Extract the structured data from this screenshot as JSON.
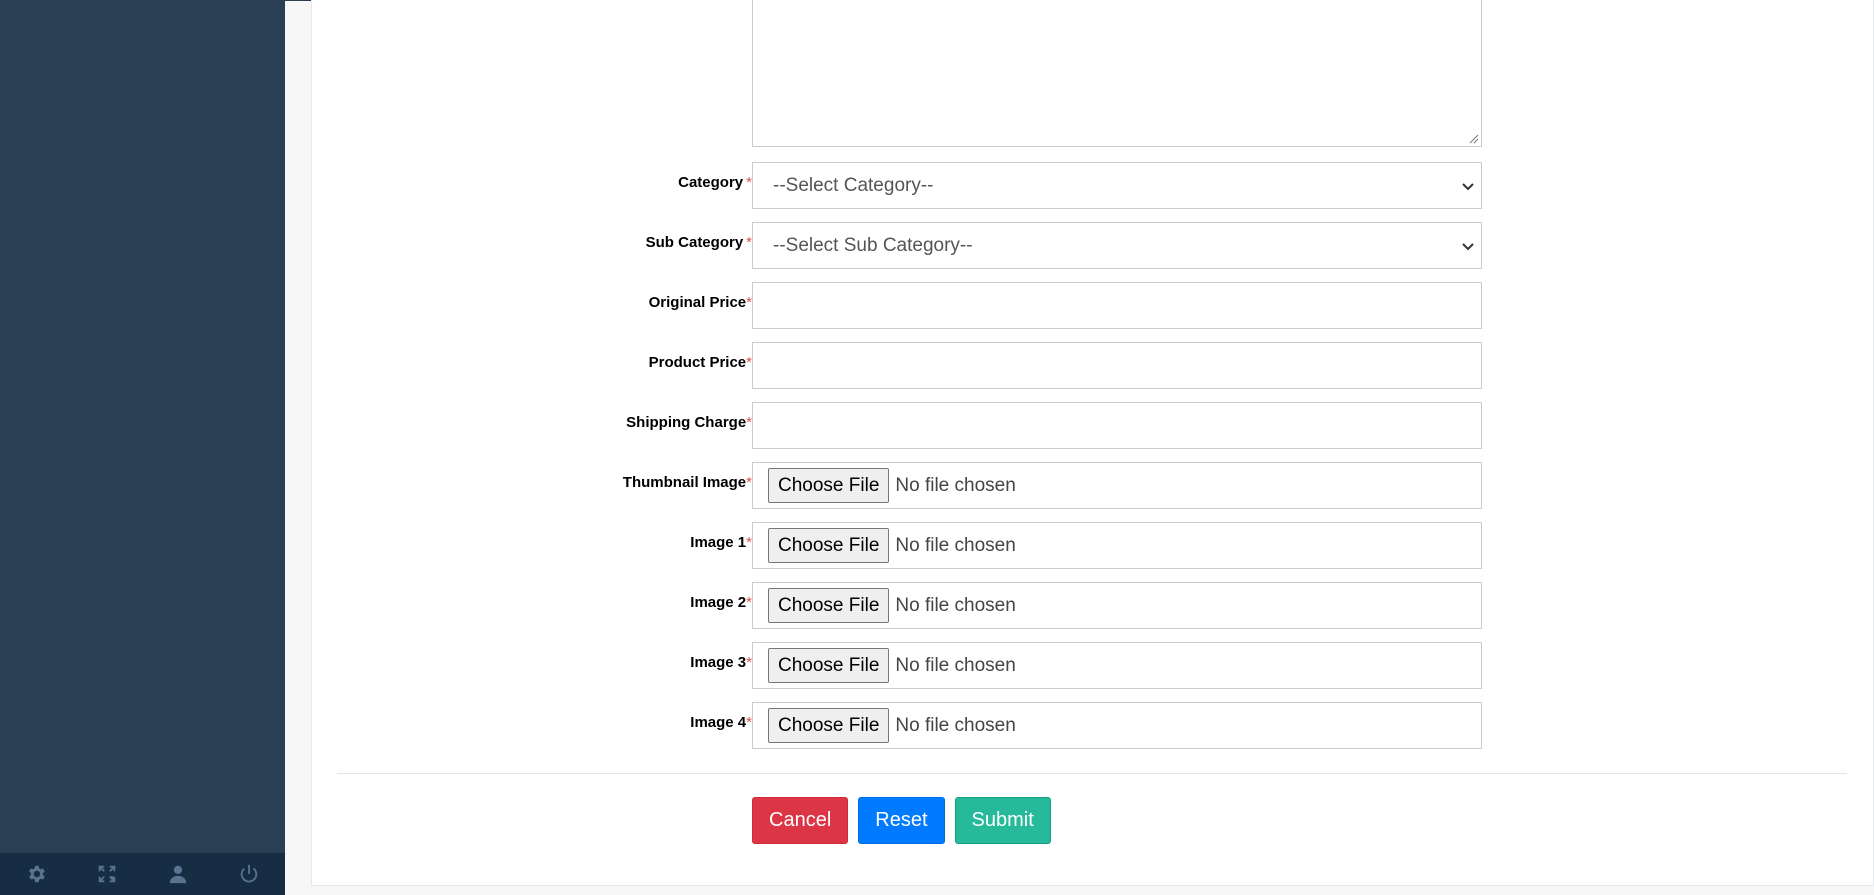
{
  "sidebar": {
    "footer_icons": [
      "gear-icon",
      "fullscreen-icon",
      "user-icon",
      "power-icon"
    ]
  },
  "form": {
    "category": {
      "label": "Category",
      "required": "*",
      "selected": "--Select Category--"
    },
    "sub_category": {
      "label": "Sub Category",
      "required": "*",
      "selected": "--Select Sub Category--"
    },
    "original_price": {
      "label": "Original Price",
      "required": "*",
      "value": ""
    },
    "product_price": {
      "label": "Product Price",
      "required": "*",
      "value": ""
    },
    "shipping_charge": {
      "label": "Shipping Charge",
      "required": "*",
      "value": ""
    },
    "thumbnail_image": {
      "label": "Thumbnail Image",
      "required": "*",
      "button": "Choose File",
      "status": "No file chosen"
    },
    "image1": {
      "label": "Image 1",
      "required": "*",
      "button": "Choose File",
      "status": "No file chosen"
    },
    "image2": {
      "label": "Image 2",
      "required": "*",
      "button": "Choose File",
      "status": "No file chosen"
    },
    "image3": {
      "label": "Image 3",
      "required": "*",
      "button": "Choose File",
      "status": "No file chosen"
    },
    "image4": {
      "label": "Image 4",
      "required": "*",
      "button": "Choose File",
      "status": "No file chosen"
    }
  },
  "actions": {
    "cancel": "Cancel",
    "reset": "Reset",
    "submit": "Submit"
  },
  "colors": {
    "sidebar": "#2a3f54",
    "cancel": "#dc3545",
    "reset": "#007bff",
    "submit": "#26b99a"
  }
}
